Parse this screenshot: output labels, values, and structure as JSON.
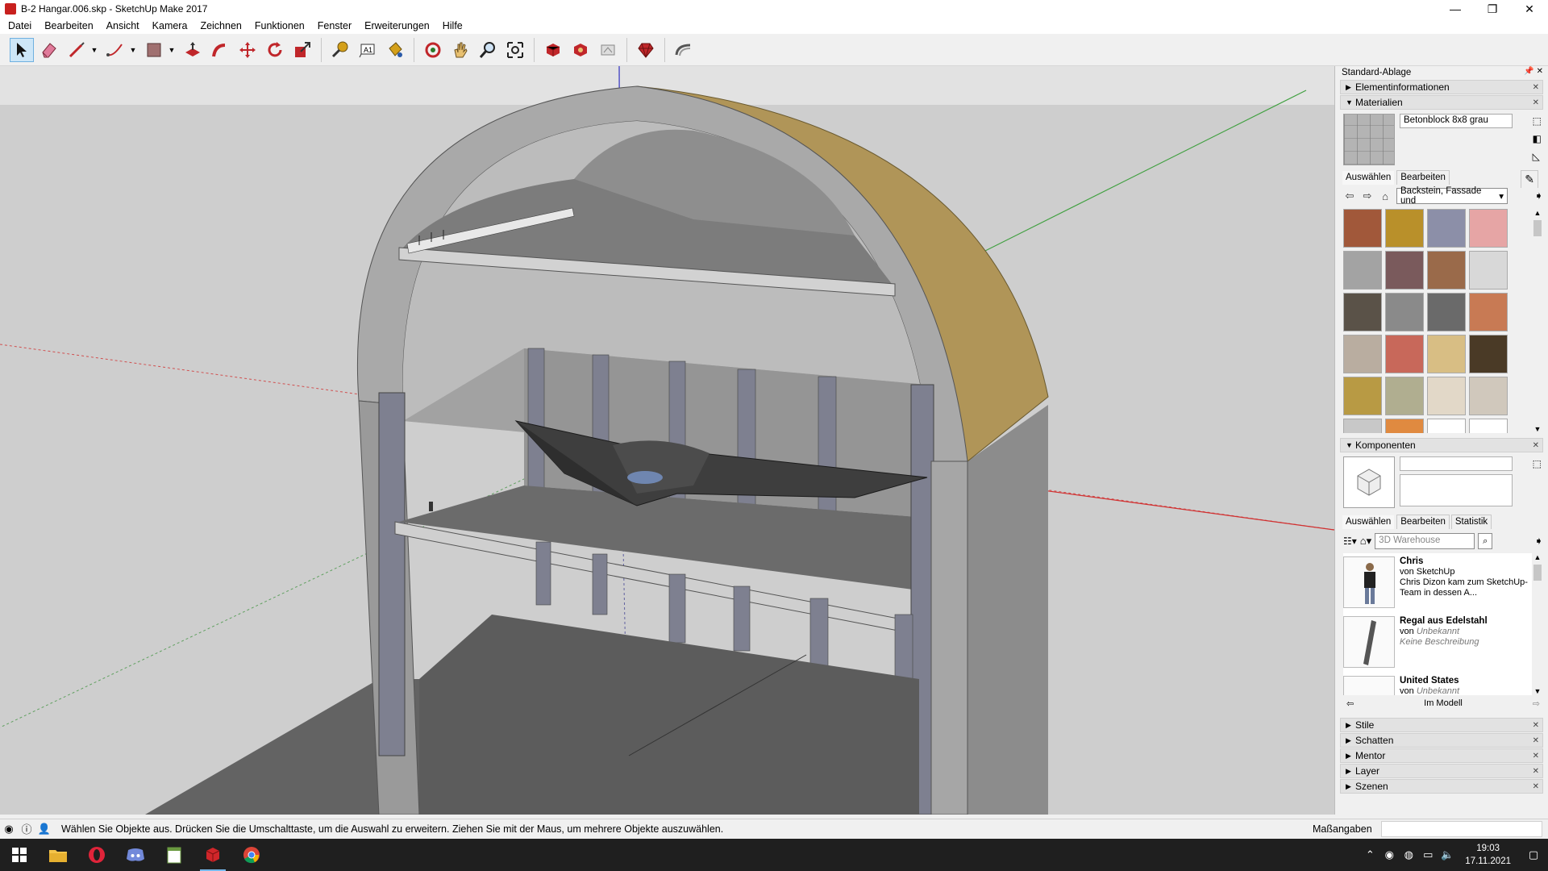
{
  "window": {
    "title": "B-2 Hangar.006.skp - SketchUp Make 2017",
    "controls": [
      "—",
      "❐",
      "✕"
    ]
  },
  "menu": [
    "Datei",
    "Bearbeiten",
    "Ansicht",
    "Kamera",
    "Zeichnen",
    "Funktionen",
    "Fenster",
    "Erweiterungen",
    "Hilfe"
  ],
  "tray": {
    "title": "Standard-Ablage",
    "panels": {
      "element_info": "Elementinformationen",
      "materials": "Materialien",
      "components": "Komponenten",
      "collapsed": [
        "Stile",
        "Schatten",
        "Mentor",
        "Layer",
        "Szenen"
      ]
    },
    "materials": {
      "current_name": "Betonblock 8x8 grau",
      "tabs": [
        "Auswählen",
        "Bearbeiten"
      ],
      "library": "Backstein, Fassade und",
      "swatch_colors": [
        "#a1583a",
        "#b9902a",
        "#8c8fa8",
        "#e6a5a5",
        "#a3a3a3",
        "#7a5a5c",
        "#9a6a4a",
        "#d8d8d8",
        "#5a5248",
        "#8a8a8a",
        "#6a6a6a",
        "#c87a54",
        "#b9ada0",
        "#c8685a",
        "#d8be84",
        "#4a3a26",
        "#b89a44",
        "#b0ae90",
        "#e2d8c8",
        "#d0c8bc",
        "#c8c8c8",
        "#e08a40",
        "#ffffff",
        "#ffffff"
      ]
    },
    "components": {
      "tabs": [
        "Auswählen",
        "Bearbeiten",
        "Statistik"
      ],
      "search_placeholder": "3D Warehouse",
      "results": [
        {
          "name": "Chris",
          "author": "von SketchUp",
          "desc": "Chris Dizon kam zum SketchUp-Team in dessen A..."
        },
        {
          "name": "Regal aus Edelstahl",
          "author_prefix": "von",
          "author": "Unbekannt",
          "desc": "Keine Beschreibung"
        },
        {
          "name": "United States",
          "author_prefix": "von",
          "author": "Unbekannt",
          "desc": ""
        }
      ],
      "in_model": "Im Modell"
    }
  },
  "status": {
    "message": "Wählen Sie Objekte aus. Drücken Sie die Umschalttaste, um die Auswahl zu erweitern. Ziehen Sie mit der Maus, um mehrere Objekte auszuwählen.",
    "measurements_label": "Maßangaben"
  },
  "taskbar": {
    "time": "19:03",
    "date": "17.11.2021"
  }
}
